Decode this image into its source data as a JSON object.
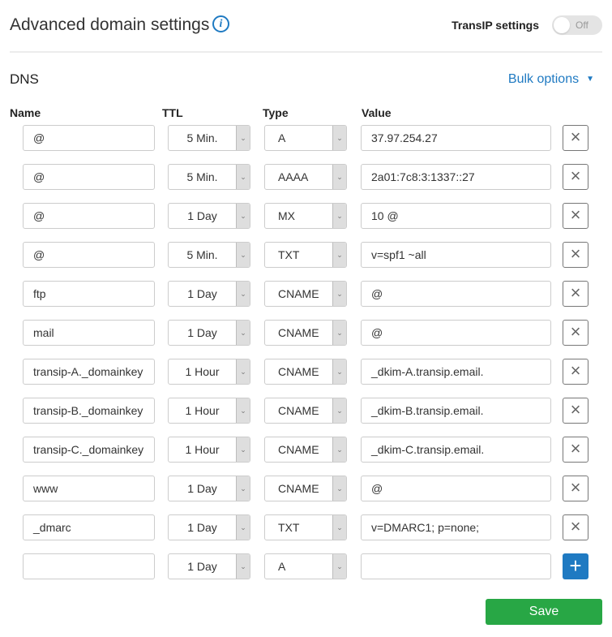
{
  "header": {
    "title": "Advanced domain settings",
    "info_icon": "i",
    "transip_settings_label": "TransIP settings",
    "transip_toggle": {
      "state": "Off",
      "on": false
    }
  },
  "dns": {
    "section_title": "DNS",
    "bulk_options_label": "Bulk options",
    "bulk_caret": "▼",
    "columns": {
      "name": "Name",
      "ttl": "TTL",
      "type": "Type",
      "value": "Value"
    },
    "records": [
      {
        "name": "@",
        "ttl": "5 Min.",
        "type": "A",
        "value": "37.97.254.27"
      },
      {
        "name": "@",
        "ttl": "5 Min.",
        "type": "AAAA",
        "value": "2a01:7c8:3:1337::27"
      },
      {
        "name": "@",
        "ttl": "1 Day",
        "type": "MX",
        "value": "10 @"
      },
      {
        "name": "@",
        "ttl": "5 Min.",
        "type": "TXT",
        "value": "v=spf1 ~all"
      },
      {
        "name": "ftp",
        "ttl": "1 Day",
        "type": "CNAME",
        "value": "@"
      },
      {
        "name": "mail",
        "ttl": "1 Day",
        "type": "CNAME",
        "value": "@"
      },
      {
        "name": "transip-A._domainkey",
        "ttl": "1 Hour",
        "type": "CNAME",
        "value": "_dkim-A.transip.email."
      },
      {
        "name": "transip-B._domainkey",
        "ttl": "1 Hour",
        "type": "CNAME",
        "value": "_dkim-B.transip.email."
      },
      {
        "name": "transip-C._domainkey",
        "ttl": "1 Hour",
        "type": "CNAME",
        "value": "_dkim-C.transip.email."
      },
      {
        "name": "www",
        "ttl": "1 Day",
        "type": "CNAME",
        "value": "@"
      },
      {
        "name": "_dmarc",
        "ttl": "1 Day",
        "type": "TXT",
        "value": "v=DMARC1; p=none;"
      }
    ],
    "new_record": {
      "name": "",
      "ttl": "1 Day",
      "type": "A",
      "value": ""
    },
    "delete_icon": "×",
    "add_icon": "+",
    "select_arrow": "⌄"
  },
  "actions": {
    "save_label": "Save"
  },
  "colors": {
    "accent": "#1f7ac2",
    "save": "#28a745"
  }
}
